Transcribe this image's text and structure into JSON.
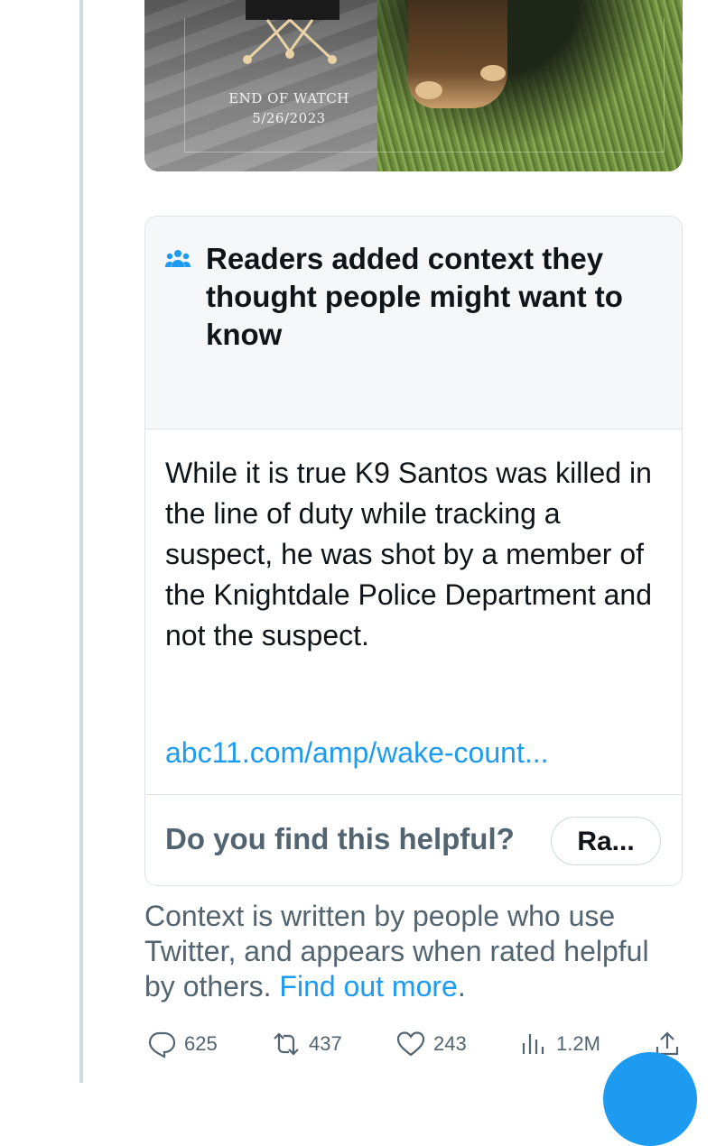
{
  "media": {
    "end_of_watch_label": "END OF WATCH",
    "end_of_watch_date": "5/26/2023"
  },
  "note": {
    "title": "Readers added context they thought people might want to know",
    "body": "While it is true K9 Santos was killed in the line of duty while tracking a suspect, he was shot by a member of the Knightdale Police Department and not the suspect.",
    "link": "abc11.com/amp/wake-count...",
    "helpful_question": "Do you find this helpful?",
    "rate_button": "Ra..."
  },
  "disclaimer": {
    "text": "Context is written by people who use Twitter, and appears when rated helpful by others.",
    "learn_more": "Find out more",
    "trailing": "."
  },
  "actions": {
    "replies": "625",
    "retweets": "437",
    "likes": "243",
    "views": "1.2M"
  },
  "colors": {
    "accent": "#1d9bf0",
    "secondary_text": "#536471",
    "primary_text": "#0f1419"
  }
}
